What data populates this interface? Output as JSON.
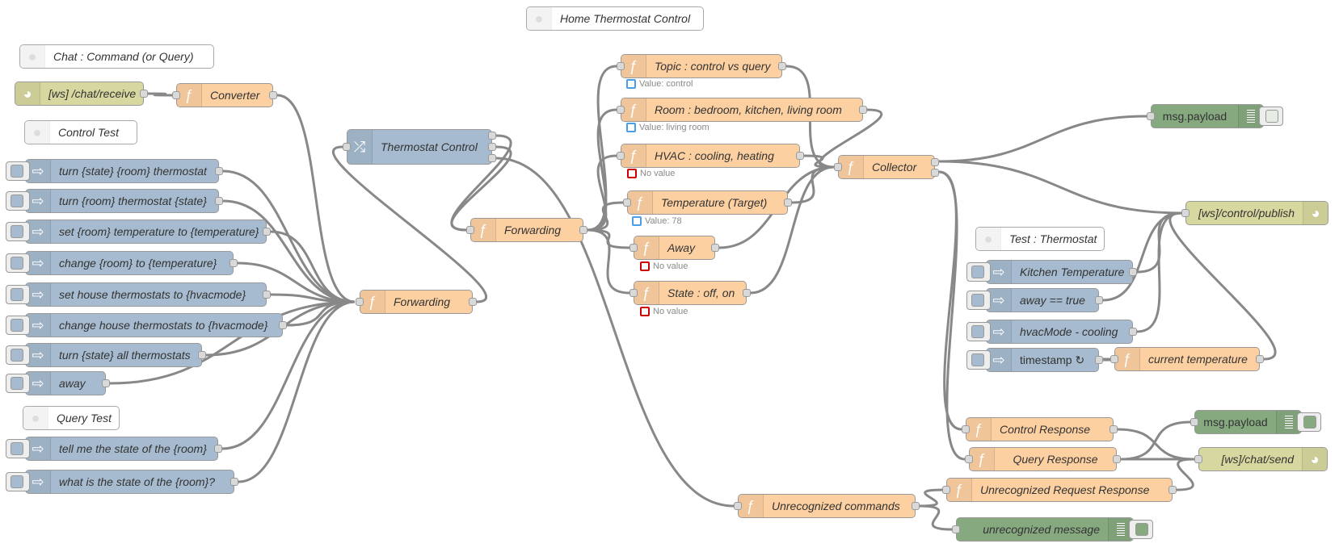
{
  "editor": {
    "colors": {
      "function": "#fdd0a2",
      "inject": "#a6bbcf",
      "websocket": "#d7d7a0",
      "debug": "#87a980",
      "switch": "#a6bbcf",
      "wire": "#888888",
      "status_blue": "#4a9ee8",
      "status_red": "#cc0000"
    },
    "comments": {
      "home": "Home Thermostat Control",
      "chat": "Chat : Command (or Query)",
      "control_test": "Control Test",
      "query_test": "Query Test",
      "test_thermostat": "Test : Thermostat"
    },
    "nodes": {
      "ws_receive": {
        "label": "[ws] /chat/receive",
        "icon": "globe-icon"
      },
      "converter": {
        "label": "Converter",
        "icon": "function-icon"
      },
      "injects_left": [
        {
          "label": "turn {state} {room} thermostat"
        },
        {
          "label": "turn {room} thermostat {state}"
        },
        {
          "label": "set {room} temperature to {temperature}"
        },
        {
          "label": "change {room} to {temperature}"
        },
        {
          "label": "set house thermostats to {hvacmode}"
        },
        {
          "label": "change house thermostats to {hvacmode}"
        },
        {
          "label": "turn {state} all thermostats"
        },
        {
          "label": "away"
        },
        {
          "label": "tell me the state of the {room}"
        },
        {
          "label": "what is the state of the {room}?"
        }
      ],
      "forwarding_left": {
        "label": "Forwarding"
      },
      "thermostat_control": {
        "label": "Thermostat Control",
        "icon": "switch-icon"
      },
      "forwarding_mid": {
        "label": "Forwarding"
      },
      "topic": {
        "label": "Topic : control vs query",
        "status": "Value: control",
        "status_color": "blue"
      },
      "room": {
        "label": "Room : bedroom, kitchen, living room",
        "status": "Value: living room",
        "status_color": "blue"
      },
      "hvac": {
        "label": "HVAC : cooling, heating",
        "status": "No value",
        "status_color": "red"
      },
      "temperature": {
        "label": "Temperature (Target)",
        "status": "Value: 78",
        "status_color": "blue"
      },
      "away": {
        "label": "Away",
        "status": "No value",
        "status_color": "red"
      },
      "state": {
        "label": "State : off, on",
        "status": "No value",
        "status_color": "red"
      },
      "collector": {
        "label": "Collector"
      },
      "debug_top": {
        "label": "msg.payload",
        "active": false
      },
      "ws_control_publish": {
        "label": "[ws]/control/publish"
      },
      "injects_right": [
        {
          "label": "Kitchen Temperature"
        },
        {
          "label": "away == true"
        },
        {
          "label": "hvacMode - cooling"
        },
        {
          "label": "timestamp ↻"
        }
      ],
      "current_temperature": {
        "label": "current temperature"
      },
      "control_response": {
        "label": "Control Response"
      },
      "query_response": {
        "label": "Query Response"
      },
      "debug_mid": {
        "label": "msg.payload",
        "active": true
      },
      "ws_chat_send": {
        "label": "[ws]/chat/send"
      },
      "unrecognized_commands": {
        "label": "Unrecognized commands"
      },
      "unrecognized_request_response": {
        "label": "Unrecognized Request Response"
      },
      "debug_unrecognized": {
        "label": "unrecognized message",
        "active": true
      }
    }
  }
}
